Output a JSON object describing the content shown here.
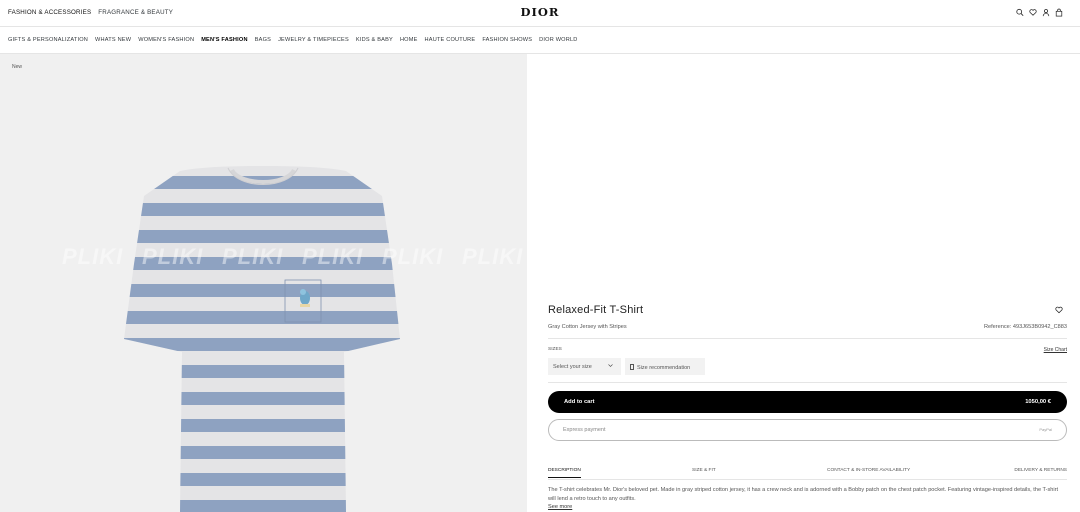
{
  "topbar": {
    "left_links": [
      "FASHION & ACCESSORIES",
      "FRAGRANCE & BEAUTY"
    ],
    "logo": "DIOR",
    "icons": [
      "search-icon",
      "heart-icon",
      "account-icon",
      "bag-icon"
    ]
  },
  "mainnav": {
    "items": [
      "GIFTS & PERSONALIZATION",
      "WHATS NEW",
      "WOMEN'S FASHION",
      "MEN'S FASHION",
      "BAGS",
      "JEWELRY & TIMEPIECES",
      "KIDS & BABY",
      "HOME",
      "HAUTE COUTURE",
      "FASHION SHOWS",
      "DIOR WORLD"
    ],
    "active": "MEN'S FASHION"
  },
  "gallery": {
    "badge": "New",
    "watermark": "PLIKI"
  },
  "product": {
    "title": "Relaxed-Fit T-Shirt",
    "subtitle": "Gray Cotton Jersey with Stripes",
    "reference": "Reference: 493J653B0942_C883",
    "sizes_label": "SIZES",
    "size_chart": "Size Chart",
    "select_placeholder": "Select your size",
    "size_recommendation": "Size recommendation",
    "add_to_cart": "Add to cart",
    "price": "1050,00 €",
    "express_payment": "Express payment",
    "express_mini": "PayPal",
    "tabs": [
      "DESCRIPTION",
      "SIZE & FIT",
      "CONTACT & IN-STORE AVAILABILITY",
      "DELIVERY & RETURNS"
    ],
    "description": "The T-shirt celebrates Mr. Dior's beloved pet. Made in gray striped cotton jersey, it has a crew neck and is adorned with a Bobby patch on the chest patch pocket. Featuring vintage-inspired details, the T-shirt will lend a retro touch to any outfits.",
    "see_more": "See more"
  },
  "colors": {
    "stripe_blue": "#8ea2c1",
    "stripe_gray": "#e4e4e6",
    "panel_bg": "#f0f0f0",
    "button_black": "#000000"
  }
}
